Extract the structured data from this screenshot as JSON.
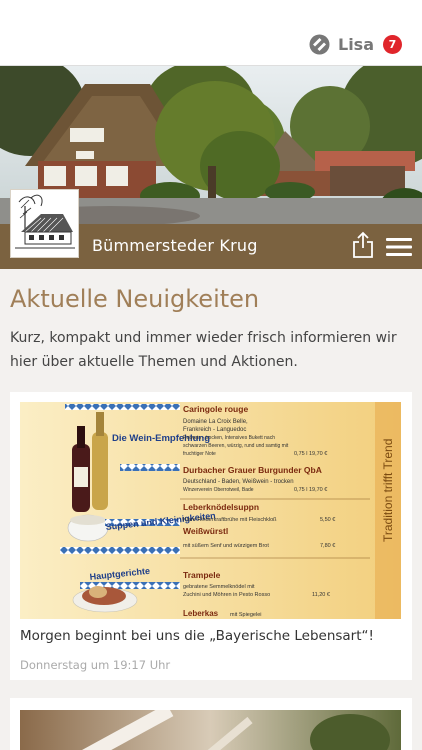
{
  "header": {
    "user_name": "Lisa",
    "notification_count": "7",
    "restaurant_name": "Bümmersteder Krug"
  },
  "page": {
    "title": "Aktuelle Neuigkeiten",
    "intro": "Kurz, kompakt und immer wieder frisch informieren wir hier über aktuelle Themen und Aktionen."
  },
  "icons": {
    "profile": "user-badge-icon",
    "share": "share-icon",
    "menu": "hamburger-menu-icon"
  },
  "colors": {
    "header_bar": "#7b6240",
    "title": "#a07f58",
    "badge": "#e0252b"
  },
  "news": [
    {
      "title": "Morgen beginnt bei uns die „Bayerische Lebensart“!",
      "date": "Donnerstag um 19:17 Uhr",
      "poster": {
        "side_text": "Tradition trifft Trend",
        "section_wine": "Die Wein-Empfehlung",
        "section_soup": "Suppen und Kleinigkeiten",
        "section_main": "Hauptgerichte",
        "items": [
          {
            "name": "Caringole rouge",
            "lines": [
              "Domaine La Croix Belle,",
              "Frankreich - Languedoc",
              "Rotwein - trocken, Intensives Bukett nach",
              "schwarzen Beeren, würzig, rund und samtig mit",
              "fruchtiger Note"
            ],
            "price": "0,75 l  19,70 €"
          },
          {
            "name": "Durbacher Grauer Burgunder QbA",
            "lines": [
              "Deutschland - Baden, Weißwein - trocken",
              "Winzerverein Oberrotweil, Bade"
            ],
            "price": "0,75 l  19,70 €"
          },
          {
            "name": "Leberknödelsuppn",
            "lines": [
              "Klare Rinderkraftbrühe mit Fleischkloß"
            ],
            "price": "5,50 €"
          },
          {
            "name": "Weißwürstl",
            "lines": [
              "mit süßem Senf und würzigem Brot"
            ],
            "price": "7,80 €"
          },
          {
            "name": "Trampele",
            "lines": [
              "gebratene Semmelknödel mit",
              "Zuchini und Möhren in Pesto Rosso"
            ],
            "price": "11,20 €"
          },
          {
            "name": "Leberkas",
            "lines": [
              "mit Spiegelei"
            ],
            "price": ""
          }
        ]
      }
    }
  ]
}
